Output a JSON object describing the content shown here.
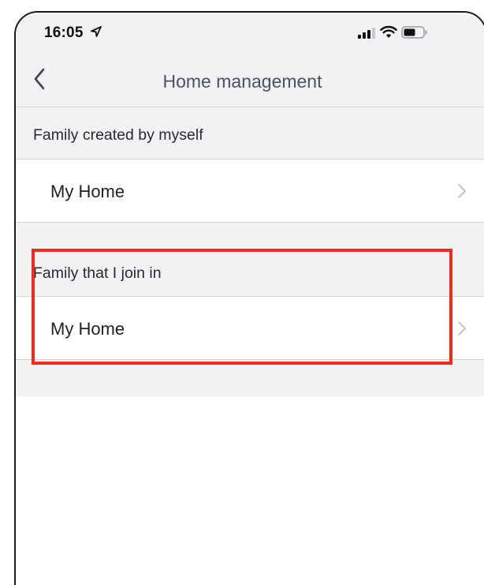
{
  "status_bar": {
    "time": "16:05",
    "icons": [
      "location-arrow-icon",
      "signal-icon",
      "wifi-icon",
      "battery-icon"
    ]
  },
  "nav": {
    "back_icon": "chevron-left-icon",
    "title": "Home management"
  },
  "sections": [
    {
      "header": "Family created by myself",
      "items": [
        {
          "label": "My Home",
          "icon": "chevron-right-icon"
        }
      ]
    },
    {
      "header": "Family that I join in",
      "items": [
        {
          "label": "My Home",
          "icon": "chevron-right-icon"
        }
      ]
    }
  ],
  "annotation": {
    "highlight_color": "#ee2b1e",
    "highlights_section": 1
  },
  "colors": {
    "background_gray": "#f2f2f4",
    "title_color": "#4b5266",
    "chevron_color": "#c4c4c8"
  }
}
